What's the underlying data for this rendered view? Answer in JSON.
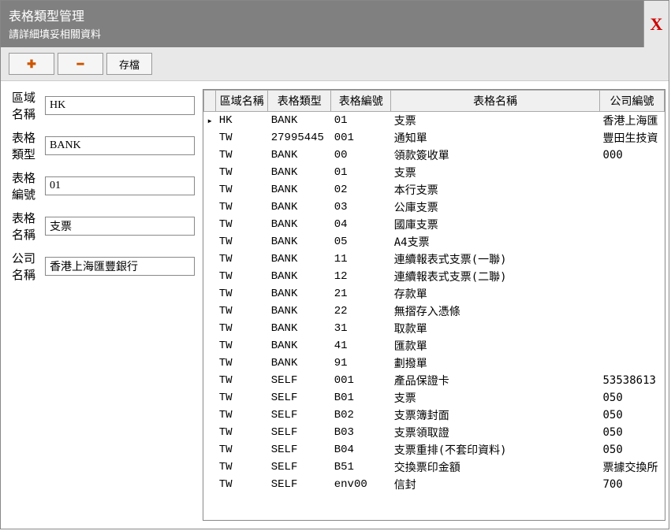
{
  "titlebar": {
    "title": "表格類型管理",
    "subtitle": "請詳細填妥相關資料",
    "close": "X"
  },
  "toolbar": {
    "add_icon": "✚",
    "remove_icon": "━",
    "save_label": "存檔"
  },
  "form": {
    "labels": {
      "region": "區域名稱",
      "type": "表格類型",
      "no": "表格編號",
      "name": "表格名稱",
      "company": "公司名稱"
    },
    "values": {
      "region": "HK",
      "type": "BANK",
      "no": "01",
      "name": "支票",
      "company": "香港上海匯豐銀行"
    }
  },
  "grid": {
    "headers": {
      "region": "區域名稱",
      "type": "表格類型",
      "no": "表格編號",
      "name": "表格名稱",
      "company": "公司編號"
    },
    "rows": [
      {
        "marker": "▸",
        "region": "HK",
        "type": "BANK",
        "no": "01",
        "name": "支票",
        "company": "香港上海匯"
      },
      {
        "marker": "",
        "region": "TW",
        "type": "27995445",
        "no": "001",
        "name": "通知單",
        "company": "豐田生技資"
      },
      {
        "marker": "",
        "region": "TW",
        "type": "BANK",
        "no": "00",
        "name": "領款簽收單",
        "company": "000"
      },
      {
        "marker": "",
        "region": "TW",
        "type": "BANK",
        "no": "01",
        "name": "支票",
        "company": ""
      },
      {
        "marker": "",
        "region": "TW",
        "type": "BANK",
        "no": "02",
        "name": "本行支票",
        "company": ""
      },
      {
        "marker": "",
        "region": "TW",
        "type": "BANK",
        "no": "03",
        "name": "公庫支票",
        "company": ""
      },
      {
        "marker": "",
        "region": "TW",
        "type": "BANK",
        "no": "04",
        "name": "國庫支票",
        "company": ""
      },
      {
        "marker": "",
        "region": "TW",
        "type": "BANK",
        "no": "05",
        "name": "A4支票",
        "company": ""
      },
      {
        "marker": "",
        "region": "TW",
        "type": "BANK",
        "no": "11",
        "name": "連續報表式支票(一聯)",
        "company": ""
      },
      {
        "marker": "",
        "region": "TW",
        "type": "BANK",
        "no": "12",
        "name": "連續報表式支票(二聯)",
        "company": ""
      },
      {
        "marker": "",
        "region": "TW",
        "type": "BANK",
        "no": "21",
        "name": "存款單",
        "company": ""
      },
      {
        "marker": "",
        "region": "TW",
        "type": "BANK",
        "no": "22",
        "name": "無摺存入憑條",
        "company": ""
      },
      {
        "marker": "",
        "region": "TW",
        "type": "BANK",
        "no": "31",
        "name": "取款單",
        "company": ""
      },
      {
        "marker": "",
        "region": "TW",
        "type": "BANK",
        "no": "41",
        "name": "匯款單",
        "company": ""
      },
      {
        "marker": "",
        "region": "TW",
        "type": "BANK",
        "no": "91",
        "name": "劃撥單",
        "company": ""
      },
      {
        "marker": "",
        "region": "TW",
        "type": "SELF",
        "no": "001",
        "name": "產品保證卡",
        "company": "53538613"
      },
      {
        "marker": "",
        "region": "TW",
        "type": "SELF",
        "no": "B01",
        "name": "支票",
        "company": "050"
      },
      {
        "marker": "",
        "region": "TW",
        "type": "SELF",
        "no": "B02",
        "name": "支票簿封面",
        "company": "050"
      },
      {
        "marker": "",
        "region": "TW",
        "type": "SELF",
        "no": "B03",
        "name": "支票領取證",
        "company": "050"
      },
      {
        "marker": "",
        "region": "TW",
        "type": "SELF",
        "no": "B04",
        "name": "支票重排(不套印資料)",
        "company": "050"
      },
      {
        "marker": "",
        "region": "TW",
        "type": "SELF",
        "no": "B51",
        "name": "交換票印金額",
        "company": "票據交換所"
      },
      {
        "marker": "",
        "region": "TW",
        "type": "SELF",
        "no": "env00",
        "name": "信封",
        "company": "700"
      }
    ]
  }
}
